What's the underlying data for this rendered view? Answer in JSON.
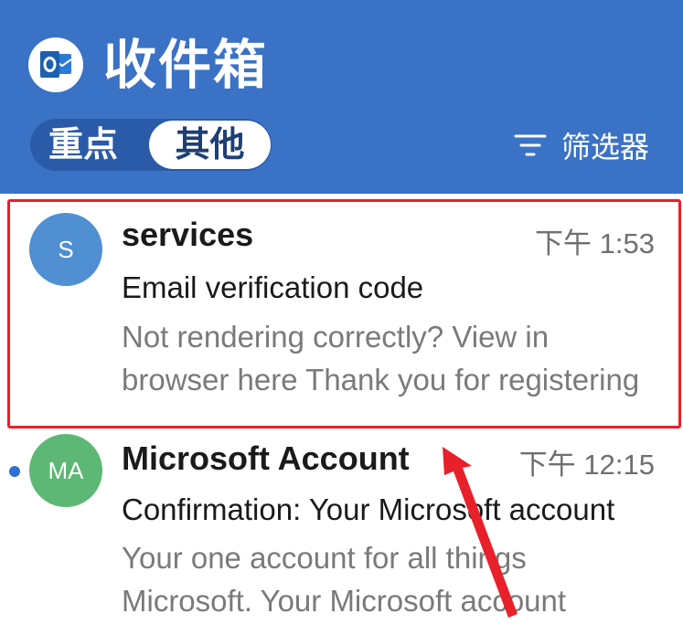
{
  "header": {
    "title": "收件箱",
    "tabs": [
      {
        "label": "重点",
        "selected": false
      },
      {
        "label": "其他",
        "selected": true
      }
    ],
    "filter_label": "筛选器",
    "background_color": "#3a72c6"
  },
  "messages": [
    {
      "avatar_initials": "S",
      "avatar_color": "#4f8fd2",
      "sender": "services",
      "time": "下午 1:53",
      "subject": "Email verification code",
      "preview": "Not rendering correctly? View in browser here Thank you for registering",
      "unread": false
    },
    {
      "avatar_initials": "MA",
      "avatar_color": "#5cb874",
      "sender": "Microsoft Account",
      "time": "下午 12:15",
      "subject": "Confirmation: Your Microsoft account",
      "preview": "Your one account for all things Microsoft. Your Microsoft account",
      "unread": true
    }
  ],
  "annotations": {
    "highlight_color": "#e8202a"
  }
}
